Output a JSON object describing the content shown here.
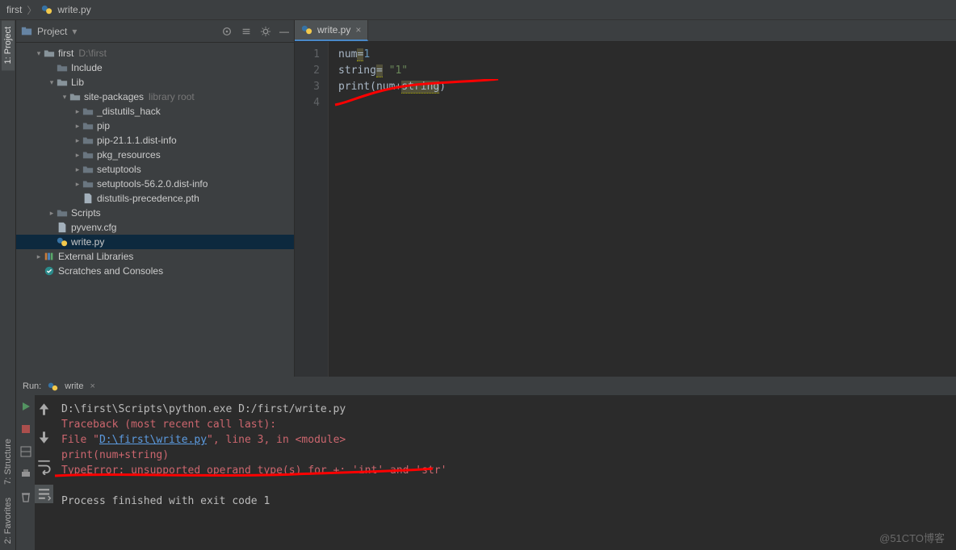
{
  "breadcrumb": {
    "root": "first",
    "file": "write.py"
  },
  "project": {
    "title": "Project",
    "root": {
      "name": "first",
      "path": "D:\\first"
    },
    "tree": [
      {
        "depth": 1,
        "exp": "down",
        "icon": "folder-open",
        "label": "first",
        "dim": "D:\\first"
      },
      {
        "depth": 2,
        "exp": "none",
        "icon": "folder",
        "label": "Include"
      },
      {
        "depth": 2,
        "exp": "down",
        "icon": "folder-open",
        "label": "Lib"
      },
      {
        "depth": 3,
        "exp": "down",
        "icon": "folder-open",
        "label": "site-packages",
        "dim": "library root"
      },
      {
        "depth": 4,
        "exp": "right",
        "icon": "folder",
        "label": "_distutils_hack"
      },
      {
        "depth": 4,
        "exp": "right",
        "icon": "folder",
        "label": "pip"
      },
      {
        "depth": 4,
        "exp": "right",
        "icon": "folder",
        "label": "pip-21.1.1.dist-info"
      },
      {
        "depth": 4,
        "exp": "right",
        "icon": "folder",
        "label": "pkg_resources"
      },
      {
        "depth": 4,
        "exp": "right",
        "icon": "folder",
        "label": "setuptools"
      },
      {
        "depth": 4,
        "exp": "right",
        "icon": "folder",
        "label": "setuptools-56.2.0.dist-info"
      },
      {
        "depth": 4,
        "exp": "none",
        "icon": "file",
        "label": "distutils-precedence.pth"
      },
      {
        "depth": 2,
        "exp": "right",
        "icon": "folder",
        "label": "Scripts"
      },
      {
        "depth": 2,
        "exp": "none",
        "icon": "file",
        "label": "pyvenv.cfg"
      },
      {
        "depth": 2,
        "exp": "none",
        "icon": "py",
        "label": "write.py",
        "selected": true
      },
      {
        "depth": 1,
        "exp": "right",
        "icon": "libs",
        "label": "External Libraries"
      },
      {
        "depth": 1,
        "exp": "none",
        "icon": "scratch",
        "label": "Scratches and Consoles"
      }
    ]
  },
  "editor": {
    "tab": "write.py",
    "lines": [
      "1",
      "2",
      "3",
      "4"
    ],
    "code": {
      "l1": {
        "a": "num",
        "b": "=",
        "c": "1"
      },
      "l2": {
        "a": "string",
        "b": "=",
        "c": " \"1\""
      },
      "l3": {
        "a": "print",
        "b": "(",
        "c": "num",
        "d": "+",
        "e": "string",
        "f": ")"
      }
    }
  },
  "run": {
    "label": "Run:",
    "config": "write",
    "lines": {
      "cmd": "D:\\first\\Scripts\\python.exe D:/first/write.py",
      "tb": "Traceback (most recent call last):",
      "file_a": "  File \"",
      "file_link": "D:\\first\\write.py",
      "file_b": "\", line 3, in <module>",
      "src": "    print(num+string)",
      "err": "TypeError: unsupported operand type(s) for +: 'int' and 'str'",
      "exit": "Process finished with exit code 1"
    }
  },
  "sideTabs": {
    "project": "1: Project",
    "structure": "7: Structure",
    "favorites": "2: Favorites"
  },
  "watermark": "@51CTO博客"
}
